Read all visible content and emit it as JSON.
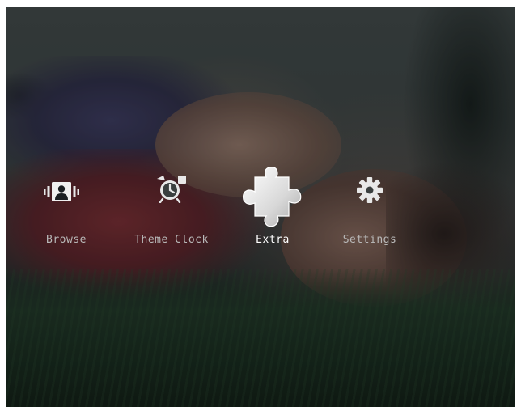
{
  "menu": {
    "items": [
      {
        "label": "Browse",
        "icon": "browse-photos-icon",
        "selected": false
      },
      {
        "label": "Theme Clock",
        "icon": "alarm-clock-icon",
        "selected": false
      },
      {
        "label": "Extra",
        "icon": "puzzle-piece-icon",
        "selected": true
      },
      {
        "label": "Settings",
        "icon": "gear-icon",
        "selected": false
      }
    ]
  },
  "colors": {
    "label_normal": "#b9b9b9",
    "label_selected": "#ffffff",
    "icon_normal": "#e8e8e8",
    "icon_selected": "#f2f2f2"
  }
}
